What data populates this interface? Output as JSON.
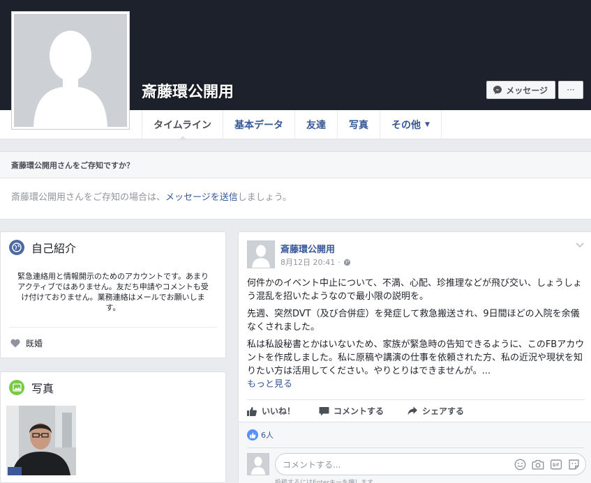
{
  "profile": {
    "name": "斎藤環公開用"
  },
  "cover_actions": {
    "message_label": "メッセージ",
    "more_label": "···"
  },
  "tabs": [
    {
      "label": "タイムライン"
    },
    {
      "label": "基本データ"
    },
    {
      "label": "友達"
    },
    {
      "label": "写真"
    },
    {
      "label": "その他"
    }
  ],
  "know_box": {
    "title": "斎藤環公開用さんをご存知ですか？",
    "body_prefix": "斎藤環公開用さんをご存知の場合は、",
    "body_link": "メッセージを送信",
    "body_suffix": "しましょう。"
  },
  "intro": {
    "title": "自己紹介",
    "text": "緊急連絡用と情報開示のためのアカウントです。あまりアクティブではありません。友だち申請やコメントも受け付けておりません。業務連絡はメールでお願いします。",
    "relationship": "既婚"
  },
  "photos": {
    "title": "写真"
  },
  "post": {
    "author": "斎藤環公開用",
    "date": "8月12日 20:41",
    "separator": "·",
    "paragraphs": [
      "何件かのイベント中止について、不満、心配、珍推理などが飛び交い、しょうしょう混乱を招いたようなので最小限の説明を。",
      "先週、突然DVT（及び合併症）を発症して救急搬送され、9日間ほどの入院を余儀なくされました。",
      "私は私設秘書とかはいないため、家族が緊急時の告知できるように、このFBアカウントを作成しました。私に原稿や講演の仕事を依頼された方、私の近況や現状を知りたい方は活用してください。やりとりはできませんが。..."
    ],
    "see_more": "もっと見る",
    "actions": {
      "like": "いいね！",
      "comment": "コメントする",
      "share": "シェアする"
    },
    "likes_count": "6人",
    "comment_placeholder": "コメントする...",
    "comment_hint": "投稿するにはEnterキーを押します。"
  },
  "colors": {
    "link": "#365899",
    "cover": "#1d212b",
    "page_bg": "#e9ebee",
    "like_blue": "#5890ff"
  }
}
